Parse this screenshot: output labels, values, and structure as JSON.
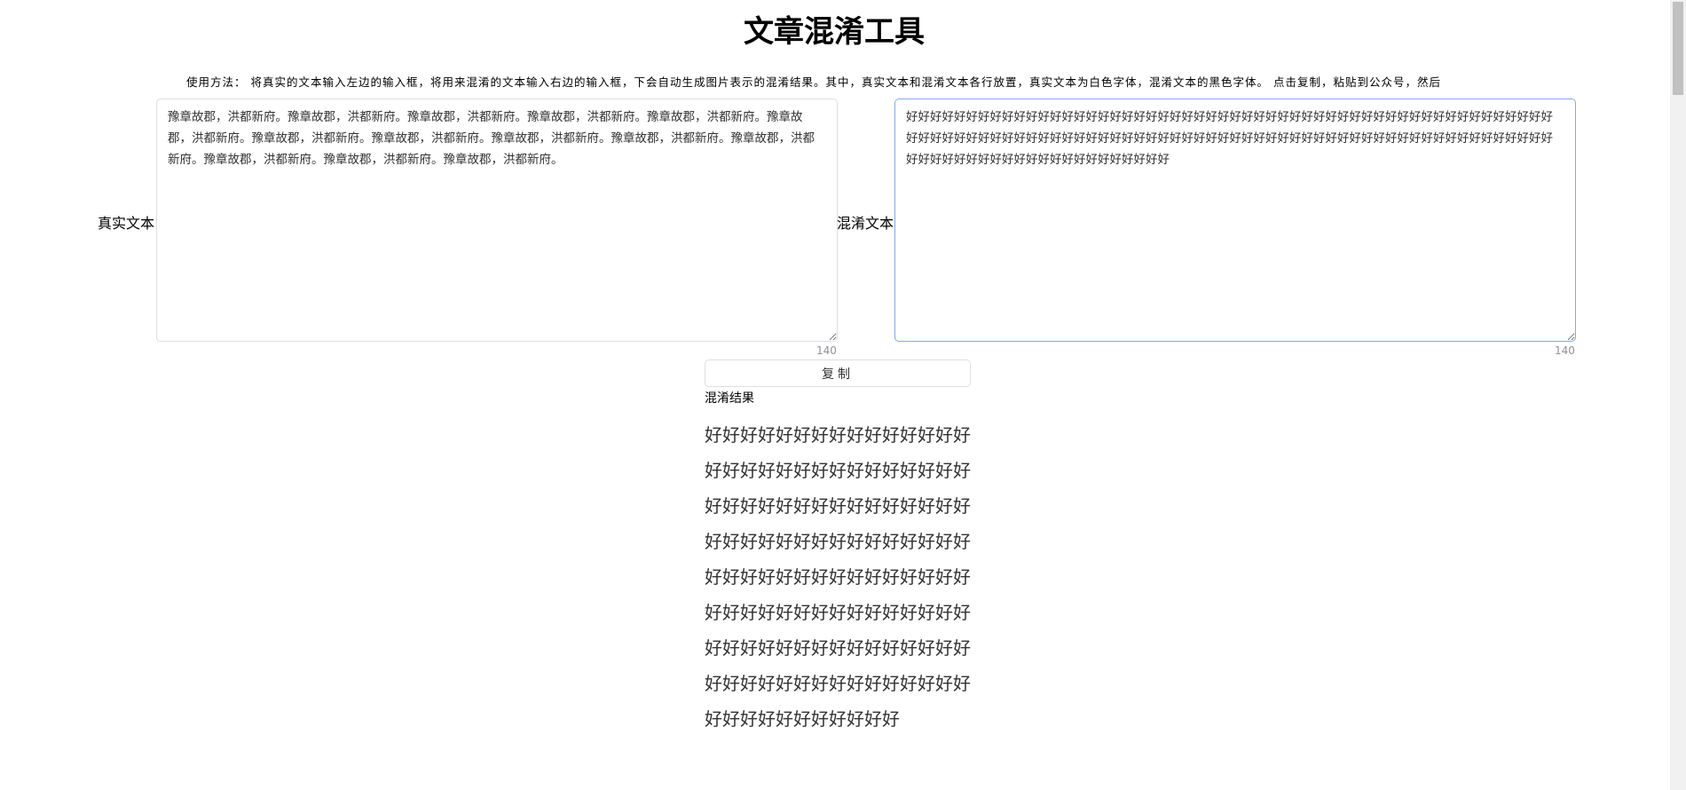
{
  "title": "文章混淆工具",
  "instructions": "使用方法： 将真实的文本输入左边的输入框，将用来混淆的文本输入右边的输入框，下会自动生成图片表示的混淆结果。其中，真实文本和混淆文本各行放置，真实文本为白色字体，混淆文本的黑色字体。 点击复制，粘贴到公众号，然后",
  "real_label": "真实文本",
  "real_text": "豫章故郡，洪都新府。豫章故郡，洪都新府。豫章故郡，洪都新府。豫章故郡，洪都新府。豫章故郡，洪都新府。豫章故郡，洪都新府。豫章故郡，洪都新府。豫章故郡，洪都新府。豫章故郡，洪都新府。豫章故郡，洪都新府。豫章故郡，洪都新府。豫章故郡，洪都新府。豫章故郡，洪都新府。豫章故郡，洪都新府。",
  "real_count": "140",
  "obf_label": "混淆文本",
  "obf_text": "好好好好好好好好好好好好好好好好好好好好好好好好好好好好好好好好好好好好好好好好好好好好好好好好好好好好好好好好好好好好好好好好好好好好好好好好好好好好好好好好好好好好好好好好好好好好好好好好好好好好好好好好好好好好好好好好好好好好好好好好好好好好好好好好好好",
  "obf_count": "140",
  "copy_label": "复制",
  "result_label": "混淆结果",
  "result_text": "好好好好好好好好好好好好好好好好好好好好好好好好好好好好好好好好好好好好好好好好好好好好好好好好好好好好好好好好好好好好好好好好好好好好好好好好好好好好好好好好好好好好好好好好好好好好好好好好好好好好好好好好好好好好好好好好好好好好好好好好好好好好好好好好好好好"
}
